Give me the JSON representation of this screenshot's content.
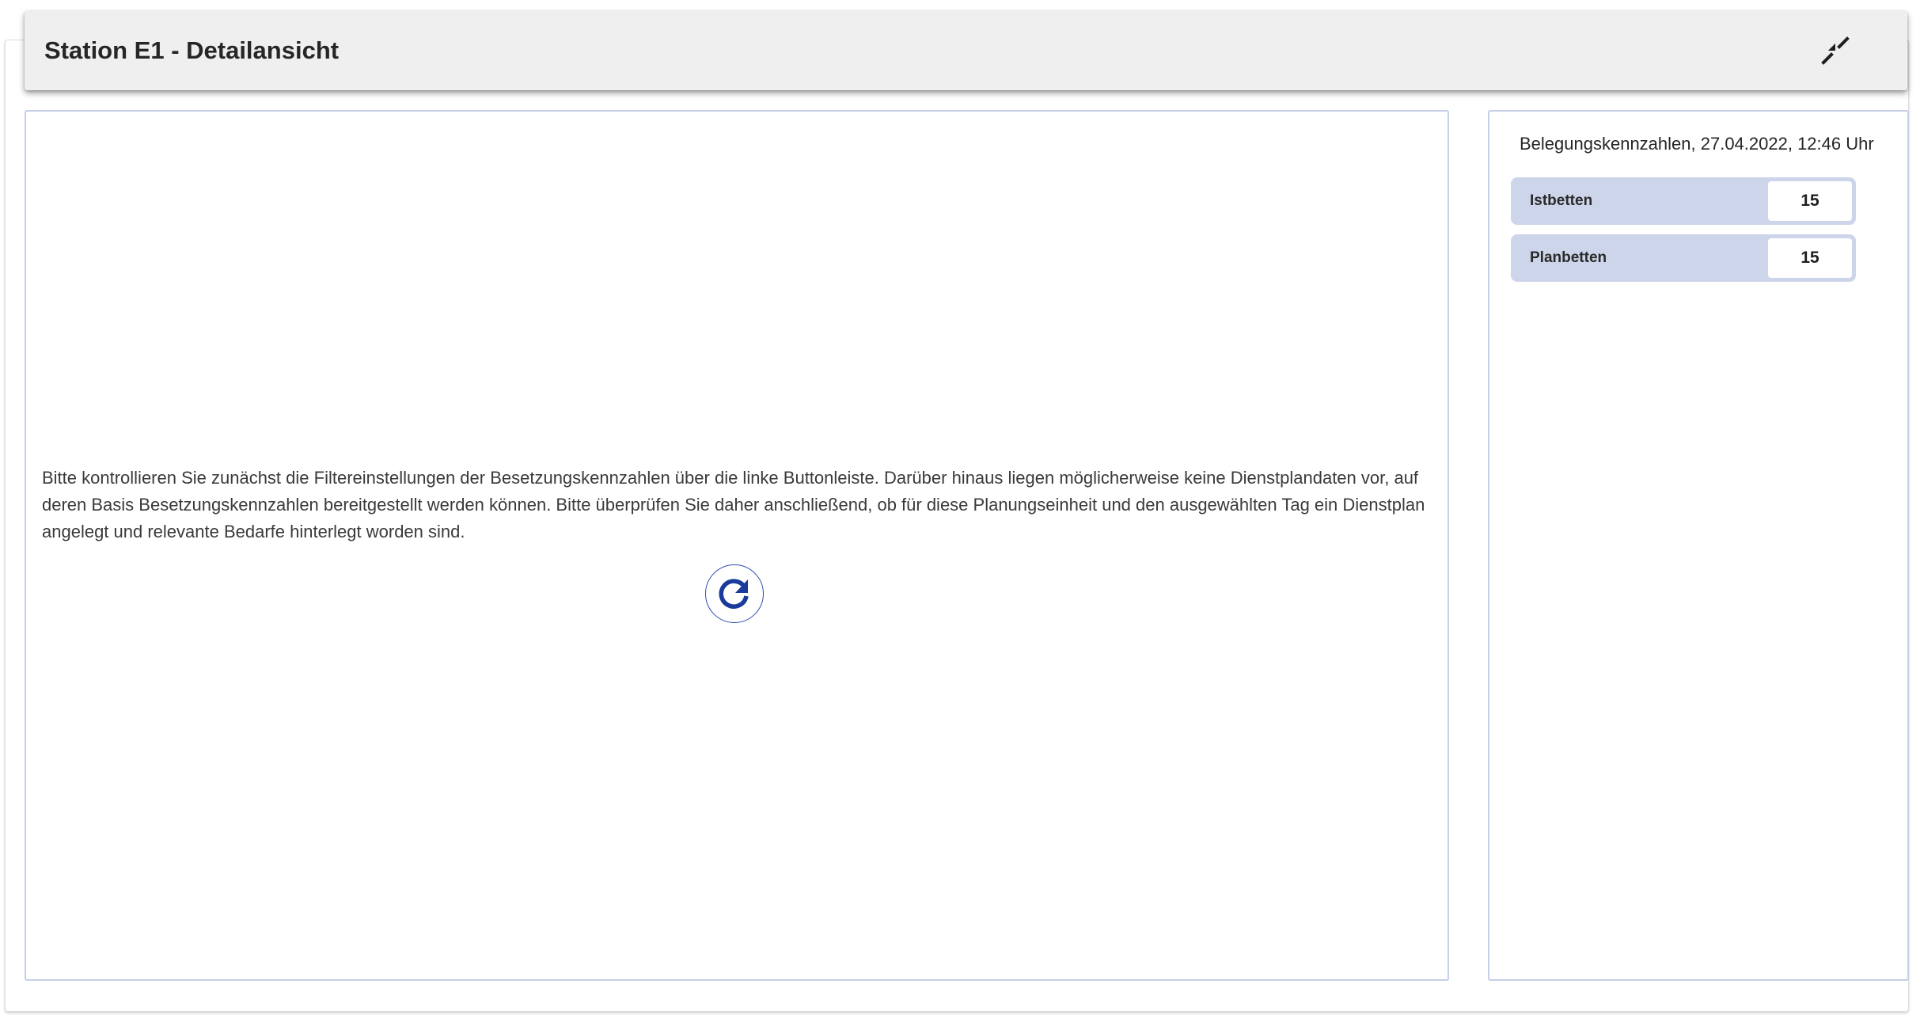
{
  "header": {
    "title": "Station E1 - Detailansicht",
    "collapse_icon": "collapse-arrows-icon"
  },
  "main": {
    "message": "Bitte kontrollieren Sie zunächst die Filtereinstellungen der Besetzungskennzahlen über die linke Buttonleiste. Darüber hinaus liegen möglicherweise keine Dienstplandaten vor, auf deren Basis Besetzungskennzahlen bereitgestellt werden können. Bitte überprüfen Sie daher anschließend, ob für diese Planungseinheit und den ausgewählten Tag ein Dienstplan angelegt und relevante Bedarfe hinterlegt worden sind.",
    "refresh_icon": "refresh-icon"
  },
  "stats": {
    "heading": "Belegungskennzahlen, 27.04.2022, 12:46 Uhr",
    "rows": [
      {
        "label": "Istbetten",
        "value": "15"
      },
      {
        "label": "Planbetten",
        "value": "15"
      }
    ]
  },
  "colors": {
    "accent": "#1a3a9c",
    "panel_border": "#c5cfe6",
    "stat_background": "#cdd5ea",
    "header_background": "#efefef"
  }
}
